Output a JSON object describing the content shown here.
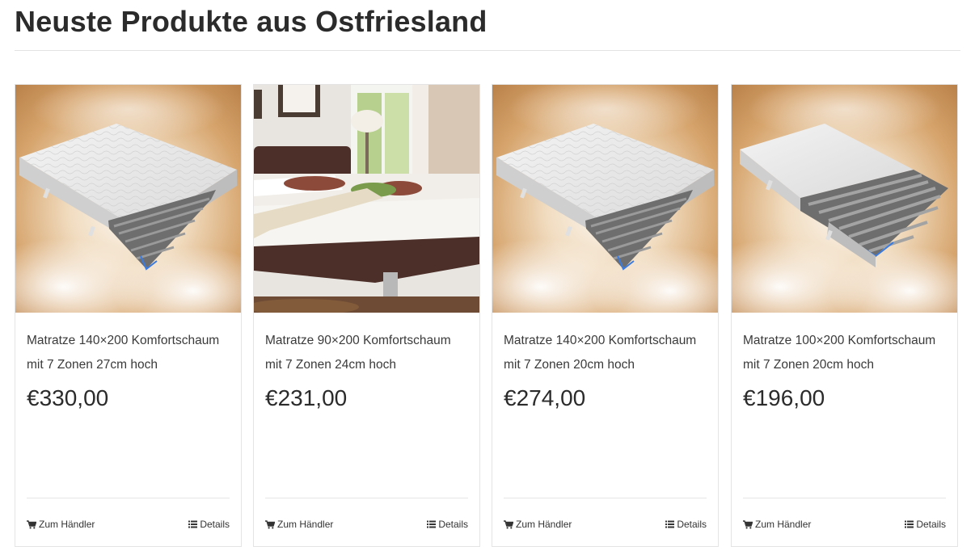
{
  "section": {
    "title": "Neuste Produkte aus Ostfriesland"
  },
  "colors": {
    "title": "#2b2b2b",
    "text": "#3a3a3a",
    "border": "#e4e4e4",
    "sky_warm": "#c8915a"
  },
  "products": [
    {
      "name": "Matratze 140×200 Komfortschaum mit 7 Zonen 27cm hoch",
      "price": "€330,00",
      "image": "mattress-render",
      "shop_label": "Zum Händler",
      "details_label": "Details"
    },
    {
      "name": "Matratze 90×200 Komfortschaum mit 7 Zonen 24cm hoch",
      "price": "€231,00",
      "image": "bedroom-photo",
      "shop_label": "Zum Händler",
      "details_label": "Details"
    },
    {
      "name": "Matratze 140×200 Komfortschaum mit 7 Zonen 20cm hoch",
      "price": "€274,00",
      "image": "mattress-render",
      "shop_label": "Zum Händler",
      "details_label": "Details"
    },
    {
      "name": "Matratze 100×200 Komfortschaum mit 7 Zonen 20cm hoch",
      "price": "€196,00",
      "image": "mattress-render-cutaway",
      "shop_label": "Zum Händler",
      "details_label": "Details"
    }
  ]
}
